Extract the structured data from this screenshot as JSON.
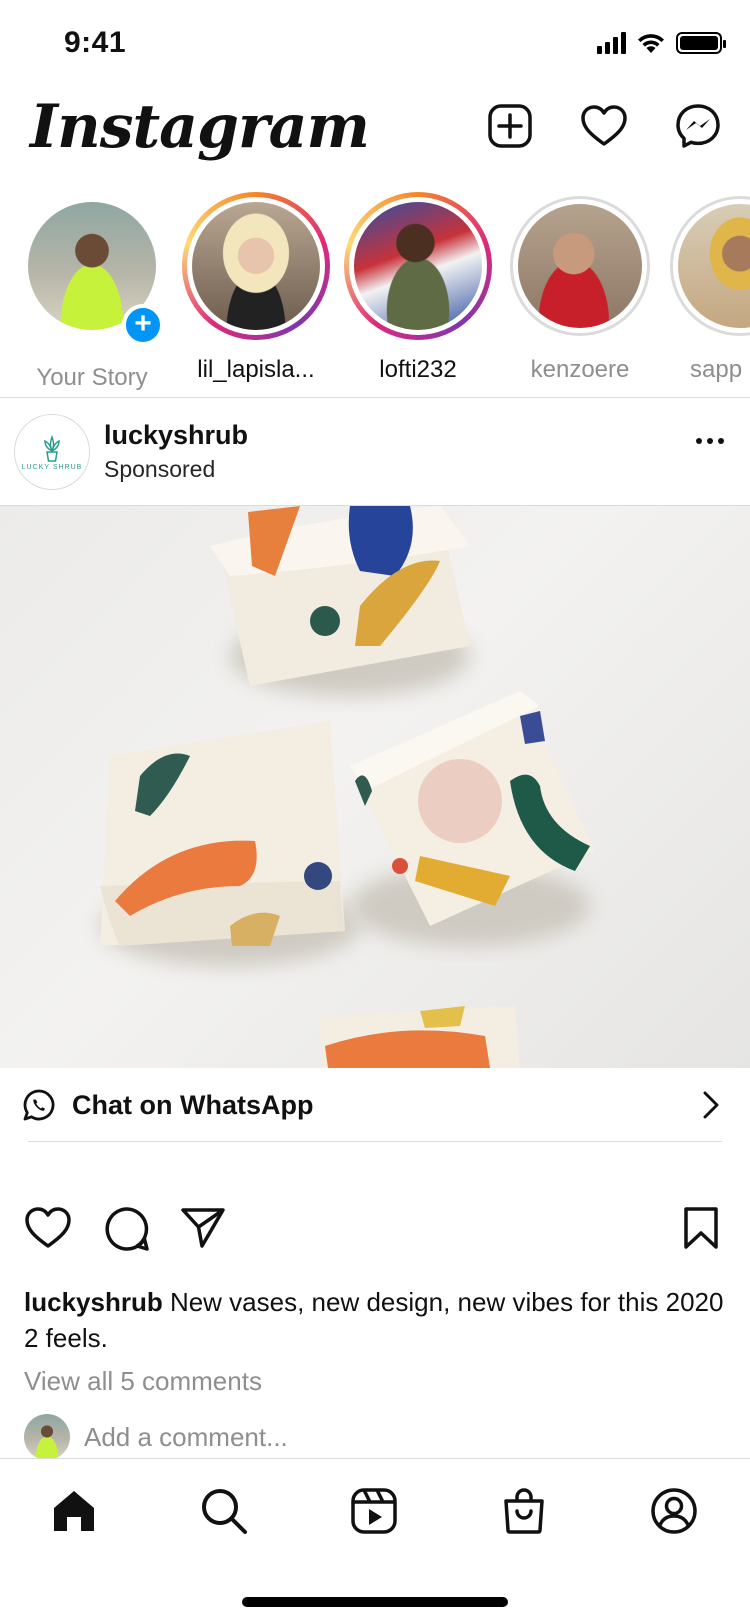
{
  "status_bar": {
    "time": "9:41"
  },
  "header": {
    "logo": "Instagram"
  },
  "stories": [
    {
      "name": "Your Story",
      "state": "own"
    },
    {
      "name": "lil_lapisla...",
      "state": "active"
    },
    {
      "name": "lofti232",
      "state": "active"
    },
    {
      "name": "kenzoere",
      "state": "seen"
    },
    {
      "name": "sapp",
      "state": "seen"
    }
  ],
  "post": {
    "user": "luckyshrub",
    "subtitle": "Sponsored",
    "brand_logo_text": "LUCKY SHRUB",
    "cta_label": "Chat on WhatsApp",
    "caption_user": "luckyshrub",
    "caption_text": " New vases, new design, new vibes for this 2020 2 feels.",
    "view_comments": "View all 5 comments",
    "add_comment_placeholder": "Add a comment..."
  },
  "tabs": [
    "home-icon",
    "search-icon",
    "reels-icon",
    "shop-icon",
    "profile-icon"
  ],
  "colors": {
    "accent_blue": "#0095f6",
    "divider": "#dbdbdb",
    "muted_text": "#8e8e8e"
  }
}
